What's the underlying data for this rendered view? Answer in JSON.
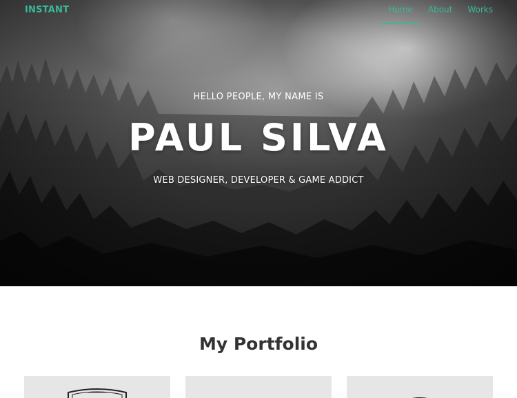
{
  "nav": {
    "brand": "INSTANT",
    "links": [
      {
        "label": "Home",
        "active": true
      },
      {
        "label": "About",
        "active": false
      },
      {
        "label": "Works",
        "active": false
      }
    ]
  },
  "hero": {
    "greeting": "HELLO PEOPLE, MY NAME IS",
    "name": "PAUL SILVA",
    "tagline": "WEB DESIGNER, DEVELOPER & GAME ADDICT"
  },
  "portfolio": {
    "title": "My Portfolio",
    "items": [
      {
        "thumb": "badge-logo"
      },
      {
        "thumb": "dark-arc-logo"
      },
      {
        "thumb": "dark-arc-logo"
      }
    ]
  },
  "colors": {
    "accent": "#3ab89a",
    "title_text": "#333333",
    "card_bg": "#e6e6e6"
  }
}
